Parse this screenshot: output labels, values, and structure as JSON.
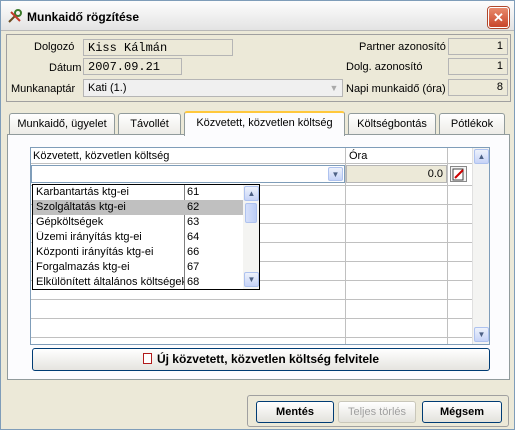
{
  "window": {
    "title": "Munkaidő rögzítése",
    "close_glyph": "✕"
  },
  "header": {
    "dolgozo_label": "Dolgozó",
    "dolgozo_value": "Kiss Kálmán",
    "datum_label": "Dátum",
    "datum_value": "2007.09.21",
    "munkanaptar_label": "Munkanaptár",
    "munkanaptar_value": "Kati (1.)",
    "partner_label": "Partner azonosító",
    "partner_value": "1",
    "dolg_label": "Dolg. azonosító",
    "dolg_value": "1",
    "napi_label": "Napi munkaidő (óra)",
    "napi_value": "8"
  },
  "tabs": [
    {
      "label": "Munkaidő, ügyelet"
    },
    {
      "label": "Távollét"
    },
    {
      "label": "Közvetett, közvetlen költség"
    },
    {
      "label": "Költségbontás"
    },
    {
      "label": "Pótlékok"
    }
  ],
  "grid": {
    "col_cost": "Közvetett, közvetlen költség",
    "col_hours": "Óra",
    "edit_hours_value": "0.0"
  },
  "dropdown": {
    "items": [
      {
        "name": "Karbantartás ktg-ei",
        "code": "61"
      },
      {
        "name": "Szolgáltatás ktg-ei",
        "code": "62"
      },
      {
        "name": "Gépköltségek",
        "code": "63"
      },
      {
        "name": "Üzemi irányítás ktg-ei",
        "code": "64"
      },
      {
        "name": "Központi irányítás ktg-ei",
        "code": "66"
      },
      {
        "name": "Forgalmazás ktg-ei",
        "code": "67"
      },
      {
        "name": "Elkülönített általános költségek",
        "code": "68"
      }
    ],
    "selected_index": 1
  },
  "new_button_label": "Új közvetett, közvetlen költség  felvitele",
  "buttons": {
    "save": "Mentés",
    "delete_all": "Teljes törlés",
    "cancel": "Mégsem"
  },
  "colors": {
    "tab_highlight": "#ffc83c",
    "close_red": "#c8452a",
    "border_blue": "#7f9db9"
  }
}
